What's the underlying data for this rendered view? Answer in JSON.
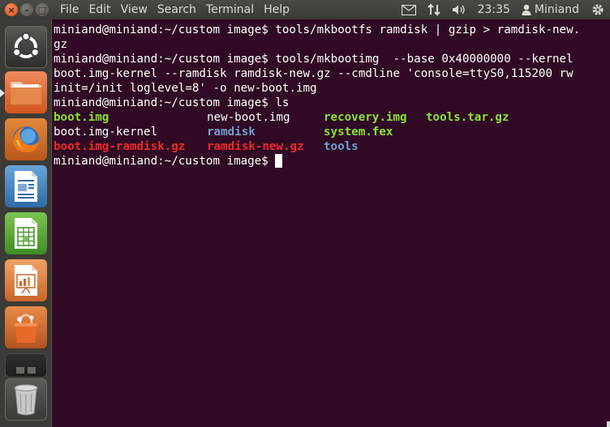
{
  "menu_bar": {
    "items": [
      "File",
      "Edit",
      "View",
      "Search",
      "Terminal",
      "Help"
    ]
  },
  "tray": {
    "clock": "23:35",
    "user_name": "Miniand"
  },
  "launcher": {
    "icons": [
      "ubuntu-dash-icon",
      "home-folder-icon",
      "firefox-icon",
      "libreoffice-writer-icon",
      "libreoffice-calc-icon",
      "libreoffice-impress-icon",
      "software-center-icon",
      "workspace-switcher-icon",
      "trash-icon"
    ]
  },
  "terminal": {
    "lines": [
      "miniand@miniand:~/custom image$ tools/mkbootfs ramdisk | gzip > ramdisk-new.",
      "gz",
      "miniand@miniand:~/custom image$ tools/mkbootimg  --base 0x40000000 --kernel",
      "boot.img-kernel --ramdisk ramdisk-new.gz --cmdline 'console=ttyS0,115200 rw",
      "init=/init loglevel=8' -o new-boot.img",
      "miniand@miniand:~/custom image$ ls"
    ],
    "ls_rows": [
      [
        "boot.img",
        "new-boot.img",
        "recovery.img",
        "tools.tar.gz"
      ],
      [
        "boot.img-kernel",
        "ramdisk",
        "system.fex",
        ""
      ],
      [
        "boot.img-ramdisk.gz",
        "ramdisk-new.gz",
        "tools",
        ""
      ]
    ],
    "prompt": "miniand@miniand:~/custom image$ ",
    "colors": {
      "background": "#300a24",
      "executable": "#8ae234",
      "directory": "#729fcf",
      "archive": "#ef2929"
    }
  }
}
